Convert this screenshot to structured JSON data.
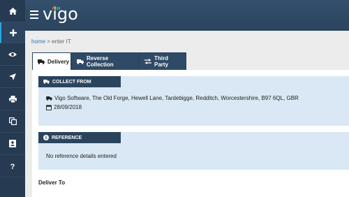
{
  "app": {
    "logo_text": "vigo",
    "logo_colors": [
      "#e63c3c",
      "#f5a623",
      "#3bb54a",
      "#2aa7e0"
    ]
  },
  "sidebar": {
    "items": [
      {
        "icon": "home-icon",
        "name": "home"
      },
      {
        "icon": "plus-icon",
        "name": "add",
        "active": true
      },
      {
        "icon": "eye-icon",
        "name": "view"
      },
      {
        "icon": "location-arrow-icon",
        "name": "track"
      },
      {
        "icon": "print-icon",
        "name": "print"
      },
      {
        "icon": "copy-icon",
        "name": "copy"
      },
      {
        "icon": "address-book-icon",
        "name": "contacts"
      },
      {
        "icon": "help-icon",
        "name": "help"
      }
    ]
  },
  "breadcrumb": {
    "home": "home",
    "separator": ">",
    "current": "enter IT"
  },
  "tabs": [
    {
      "label": "Delivery",
      "icon": "truck-icon",
      "active": true
    },
    {
      "label": "Reverse Collection",
      "icon": "truck-icon",
      "active": false
    },
    {
      "label": "Third Party",
      "icon": "exchange-icon",
      "active": false
    }
  ],
  "collect_from": {
    "title": "COLLECT FROM",
    "address": "Vigo Software, The Old Forge, Hewell Lane, Tardebigge, Redditch, Worcestershire, B97 6QL, GBR",
    "date": "28/09/2018"
  },
  "reference": {
    "title": "REFERENCE",
    "text": "No reference details entered"
  },
  "deliver_to": {
    "title": "Deliver To"
  },
  "colors": {
    "rail": "#263a51",
    "header": "#2b445e",
    "accent": "#2aa7e0",
    "card": "#d9e8f4"
  }
}
